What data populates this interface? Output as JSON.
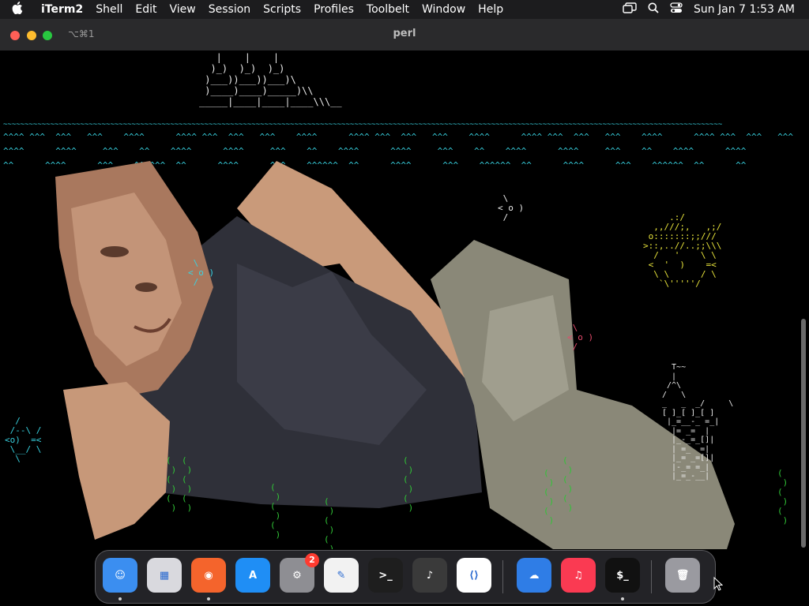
{
  "menubar": {
    "app_name": "iTerm2",
    "menus": [
      "Shell",
      "Edit",
      "View",
      "Session",
      "Scripts",
      "Profiles",
      "Toolbelt",
      "Window",
      "Help"
    ],
    "clock": "Sun Jan 7  1:53 AM",
    "status_icons": [
      "screen-mirroring-icon",
      "search-icon",
      "control-center-icon"
    ]
  },
  "window": {
    "title": "perl",
    "tab_shortcut": "⌥⌘1"
  },
  "terminal": {
    "ship": "   |    |    |\n  )_)  )_)  )_)\n )___))___))___)\\\n )____)____)_____)\\\\\n_____|____|____|____\\\\\\__",
    "water": [
      "~~~~~~~~~~~~~~~~~~~~~~~~~~~~~~~~~~~~~~~~~~~~~~~~~~~~~~~~~~~~~~~~~~~~~~~~~~~~~~~~~~~~~~~~~~~~~~~~~~~~~~~~~~~~~~~~~~~~~~~~~~~~~~~~~~~~~~~~~~~~~~~~~~~~~~~~~~~~~~~~~~~~~~~~",
      "^^^^ ^^^  ^^^   ^^^    ^^^^      ^^^^ ^^^  ^^^   ^^^    ^^^^      ^^^^ ^^^  ^^^   ^^^    ^^^^      ^^^^ ^^^  ^^^   ^^^    ^^^^      ^^^^ ^^^  ^^^   ^^^",
      "^^^^      ^^^^     ^^^    ^^    ^^^^      ^^^^     ^^^    ^^    ^^^^      ^^^^     ^^^    ^^    ^^^^      ^^^^     ^^^    ^^    ^^^^      ^^^^",
      "^^      ^^^^      ^^^    ^^^^^^  ^^      ^^^^      ^^^    ^^^^^^  ^^      ^^^^      ^^^    ^^^^^^  ^^      ^^^^      ^^^    ^^^^^^  ^^      ^^"
    ],
    "fish_small": " \\\n< o )\n /",
    "fish_left": "  /\n /--\\ /\n<o)  =<\n \\__/ \\\n  \\",
    "fish_big": "     .:/\n  ,,///;,   ,;/\n o:::::::;;///\n>::,..//..;;\\\\\\\n  /   '    \\ \\\n <  '  )    =<\n  \\ \\      / \\\n   `\\'''''/",
    "castle": "  T~~\n  |\n /^\\\n/   \\\n_   _  _/     \\\n[ ]_[ ]_[ ]\n |_=__-_ =_|\n  |= _=  |\n  |_-_=_[]|\n  | =_  =|\n  |_= _=[]|\n  |-_= =_|\n  |_=_-__|",
    "seaweed": "(\n )\n(\n )\n(\n )"
  },
  "dock": {
    "apps": [
      {
        "name": "Finder",
        "icon": "finder-icon",
        "color": "#3b8ef0",
        "running": true
      },
      {
        "name": "Launchpad",
        "icon": "launchpad-icon",
        "color": "#d9d9de",
        "running": false
      },
      {
        "name": "Firefox",
        "icon": "firefox-icon",
        "color": "#f4642c",
        "running": true
      },
      {
        "name": "App Store",
        "icon": "app-store-icon",
        "color": "#1f8ef5",
        "running": false
      },
      {
        "name": "System Settings",
        "icon": "settings-icon",
        "color": "#8e8e93",
        "running": false,
        "badge": "2"
      },
      {
        "name": "TextEdit",
        "icon": "textedit-icon",
        "color": "#f2f2f2",
        "running": false
      },
      {
        "name": "Terminal",
        "icon": "terminal-icon",
        "color": "#1e1e1e",
        "running": false
      },
      {
        "name": "GarageBand",
        "icon": "garageband-icon",
        "color": "#3a3a3a",
        "running": false
      },
      {
        "name": "Visual Studio Code",
        "icon": "vscode-icon",
        "color": "#ffffff",
        "running": false
      },
      {
        "name": "Weather",
        "icon": "weather-icon",
        "color": "#2f7de6",
        "running": false
      },
      {
        "name": "Music",
        "icon": "music-icon",
        "color": "#fa3a52",
        "running": false
      },
      {
        "name": "iTerm2",
        "icon": "iterm-icon",
        "color": "#111111",
        "running": true
      },
      {
        "name": "Trash",
        "icon": "trash-icon",
        "color": "#9a9aa0",
        "running": false
      }
    ]
  }
}
